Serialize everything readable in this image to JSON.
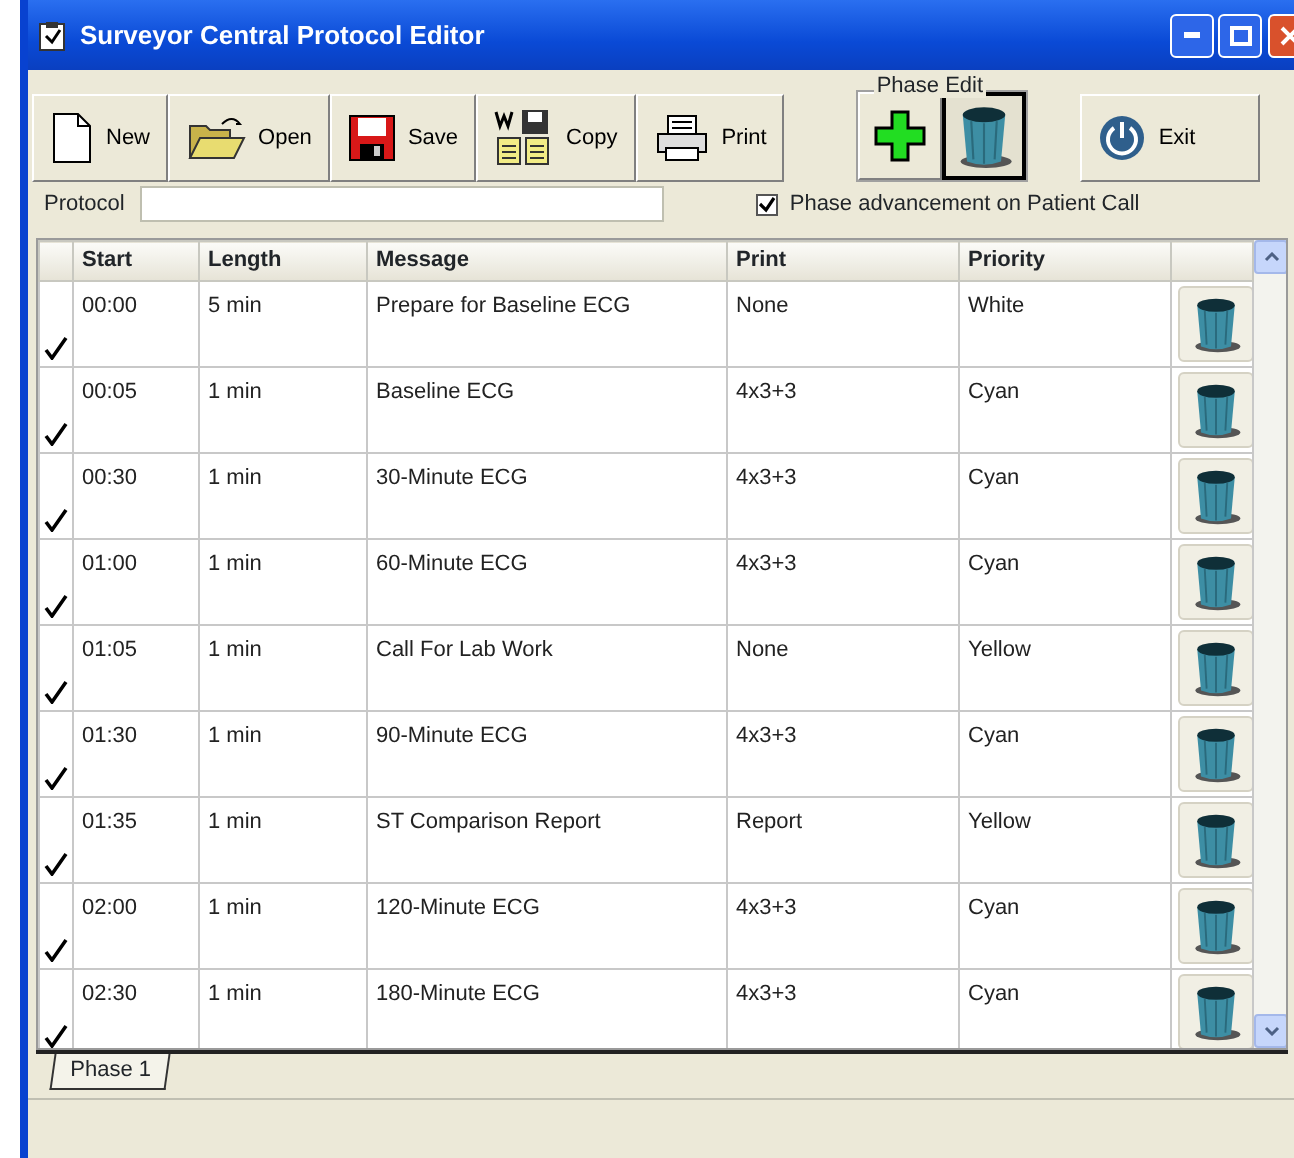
{
  "window": {
    "title": "Surveyor Central Protocol Editor"
  },
  "toolbar": [
    {
      "kind": "new",
      "label": "New"
    },
    {
      "kind": "open",
      "label": "Open"
    },
    {
      "kind": "save",
      "label": "Save"
    },
    {
      "kind": "copy",
      "label": "Copy"
    },
    {
      "kind": "print",
      "label": "Print"
    }
  ],
  "phase_edit": {
    "label": "Phase Edit",
    "buttons": [
      {
        "kind": "add",
        "selected": false
      },
      {
        "kind": "delete",
        "selected": true
      }
    ]
  },
  "exit": {
    "label": "Exit"
  },
  "protocol": {
    "label": "Protocol"
  },
  "phase_advancement": {
    "label": "Phase advancement on Patient Call",
    "checked": true
  },
  "table": {
    "columns": [
      "Start",
      "Length",
      "Message",
      "Print",
      "Priority"
    ],
    "rows": [
      {
        "checked": true,
        "start": "00:00",
        "length": "5 min",
        "message": "Prepare for Baseline ECG",
        "print": "None",
        "priority": "White"
      },
      {
        "checked": true,
        "start": "00:05",
        "length": "1 min",
        "message": "Baseline ECG",
        "print": "4x3+3",
        "priority": "Cyan"
      },
      {
        "checked": true,
        "start": "00:30",
        "length": "1 min",
        "message": "30-Minute ECG",
        "print": "4x3+3",
        "priority": "Cyan"
      },
      {
        "checked": true,
        "start": "01:00",
        "length": "1 min",
        "message": "60-Minute ECG",
        "print": "4x3+3",
        "priority": "Cyan"
      },
      {
        "checked": true,
        "start": "01:05",
        "length": "1 min",
        "message": "Call For Lab Work",
        "print": "None",
        "priority": "Yellow"
      },
      {
        "checked": true,
        "start": "01:30",
        "length": "1 min",
        "message": "90-Minute ECG",
        "print": "4x3+3",
        "priority": "Cyan"
      },
      {
        "checked": true,
        "start": "01:35",
        "length": "1 min",
        "message": "ST Comparison Report",
        "print": "Report",
        "priority": "Yellow"
      },
      {
        "checked": true,
        "start": "02:00",
        "length": "1 min",
        "message": "120-Minute ECG",
        "print": "4x3+3",
        "priority": "Cyan"
      },
      {
        "checked": true,
        "start": "02:30",
        "length": "1 min",
        "message": "180-Minute ECG",
        "print": "4x3+3",
        "priority": "Cyan"
      }
    ]
  },
  "tabs": [
    {
      "label": "Phase 1",
      "selected": true
    }
  ]
}
